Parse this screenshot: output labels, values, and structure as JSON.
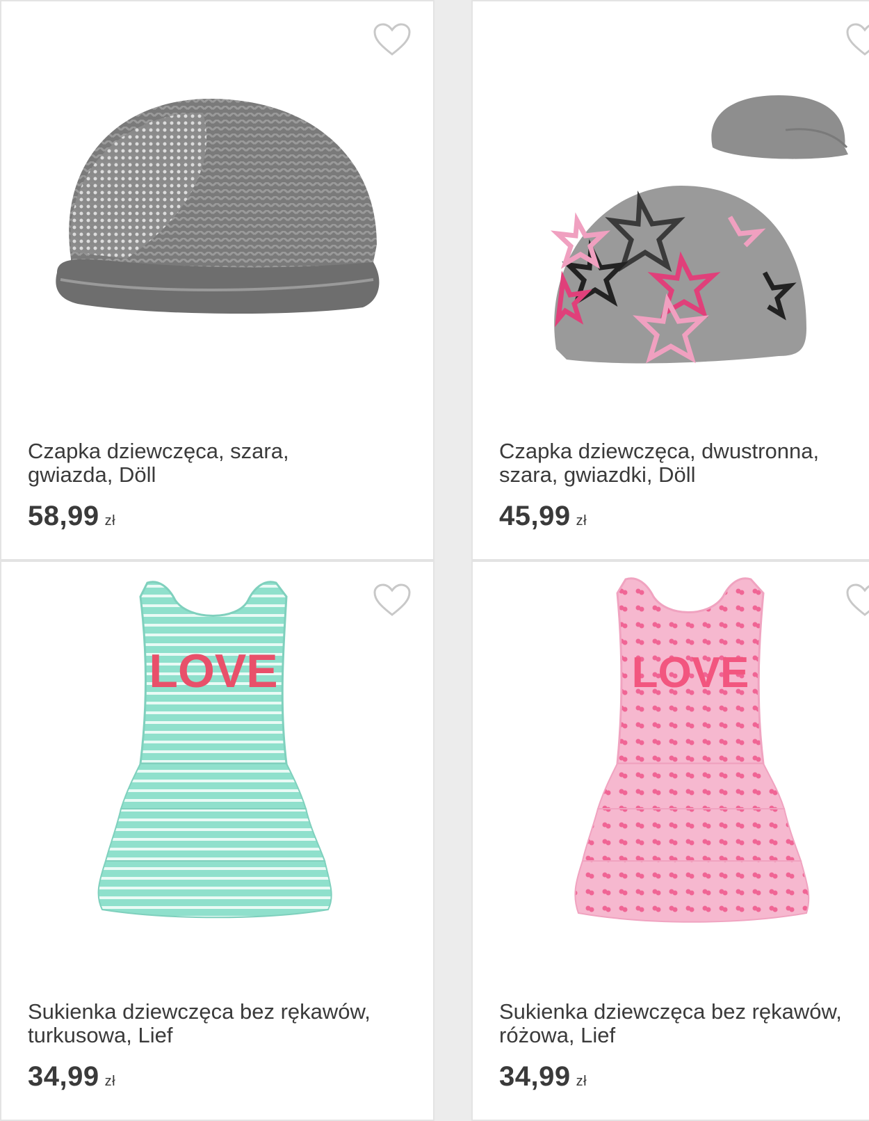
{
  "products": [
    {
      "name_line1": "Czapka dziewczęca, szara,",
      "name_line2": "gwiazda, Döll",
      "price": "58,99",
      "currency": "zł",
      "image_icon": "knit-beanie-image"
    },
    {
      "name_line1": "Czapka dziewczęca, dwustronna,",
      "name_line2": "szara, gwiazdki, Döll",
      "price": "45,99",
      "currency": "zł",
      "image_icon": "reversible-beanie-image"
    },
    {
      "name_line1": "Sukienka dziewczęca bez rękawów,",
      "name_line2": "turkusowa, Lief",
      "price": "34,99",
      "currency": "zł",
      "image_icon": "turquoise-dress-image",
      "print_text": "LOVE"
    },
    {
      "name_line1": "Sukienka dziewczęca bez rękawów,",
      "name_line2": "różowa, Lief",
      "price": "34,99",
      "currency": "zł",
      "image_icon": "pink-dress-image",
      "print_text": "LOVE"
    }
  ],
  "colors": {
    "card_bg": "#ffffff",
    "card_border": "#e3e3e3",
    "text": "#3a3a3a",
    "heart": "#c8c8c8"
  }
}
